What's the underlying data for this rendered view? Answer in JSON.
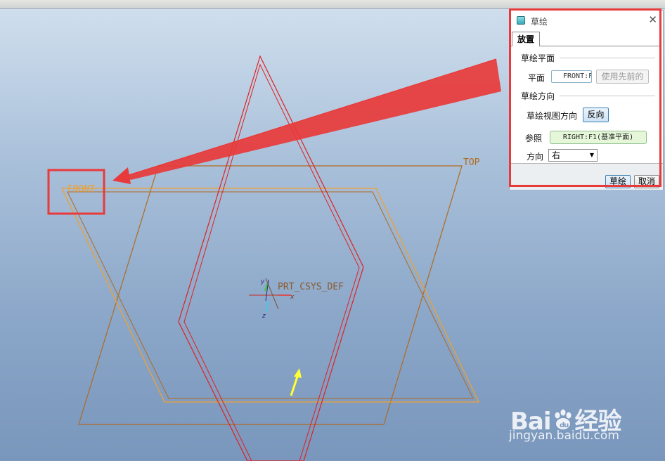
{
  "viewport": {
    "labels": {
      "front": "FRONT",
      "top": "TOP",
      "csys": "PRT_CSYS_DEF"
    },
    "axes": {
      "x": "x",
      "y": "y",
      "z": "z"
    },
    "colors": {
      "datum_plane": "#b06a20",
      "front_plane": "#f0a030",
      "sketch_outline": "#e02020",
      "annotation": "#e83a3a",
      "arrow": "#ffff33"
    }
  },
  "dialog": {
    "icon": "sketch-icon",
    "title": "草绘",
    "close_icon": "close-icon",
    "tabs": [
      {
        "label": "放置",
        "selected": true
      }
    ],
    "sketch_plane": {
      "heading": "草绘平面",
      "plane_label": "平面",
      "plane_value": "FRONT:F",
      "use_previous_label": "使用先前的"
    },
    "sketch_orientation": {
      "heading": "草绘方向",
      "view_direction_label": "草绘视图方向",
      "flip_label": "反向",
      "reference_label": "参照",
      "reference_value": "RIGHT:F1(基准平面)",
      "orientation_label": "方向",
      "orientation_value": "右"
    },
    "buttons": {
      "sketch": "草绘",
      "cancel": "取消"
    }
  },
  "watermark": {
    "brand_left": "Bai",
    "brand_right": "经验",
    "url": "jingyan.baidu.com"
  }
}
